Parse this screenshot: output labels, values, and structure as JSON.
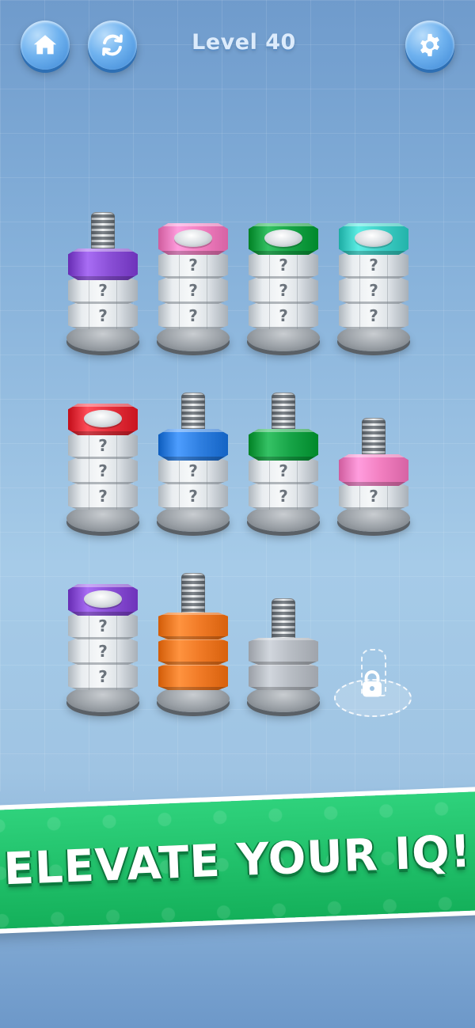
{
  "header": {
    "level_label": "Level 40",
    "home_icon": "home-icon",
    "restart_icon": "restart-icon",
    "settings_icon": "gear-icon"
  },
  "board": {
    "rows": [
      [
        {
          "top_color": "#8a4fd6",
          "top_kind": "nut",
          "mystery": 2
        },
        {
          "top_color": "#f27fc0",
          "top_kind": "nut-covered",
          "mystery": 3
        },
        {
          "top_color": "#17a447",
          "top_kind": "nut-covered",
          "mystery": 3
        },
        {
          "top_color": "#3fcfc6",
          "top_kind": "nut-covered",
          "mystery": 3
        }
      ],
      [
        {
          "top_color": "#e5303c",
          "top_kind": "nut-covered",
          "mystery": 3
        },
        {
          "top_color": "#2f7fe0",
          "top_kind": "nut",
          "mystery": 2
        },
        {
          "top_color": "#17a447",
          "top_kind": "nut",
          "mystery": 2
        },
        {
          "top_color": "#f27fc0",
          "top_kind": "nut",
          "mystery": 1
        }
      ],
      [
        {
          "top_color": "#8a4fd6",
          "top_kind": "nut-covered",
          "mystery": 3
        },
        {
          "top_color": "#f07a26",
          "top_kind": "orange-stack",
          "mystery": 0
        },
        {
          "top_color": "#b8bdc4",
          "top_kind": "gray-stack",
          "mystery": 0
        }
      ]
    ],
    "locked_slot_icon": "lock-icon",
    "mystery_mark": "?"
  },
  "banner": {
    "text": "ELEVATE YOUR IQ!"
  }
}
